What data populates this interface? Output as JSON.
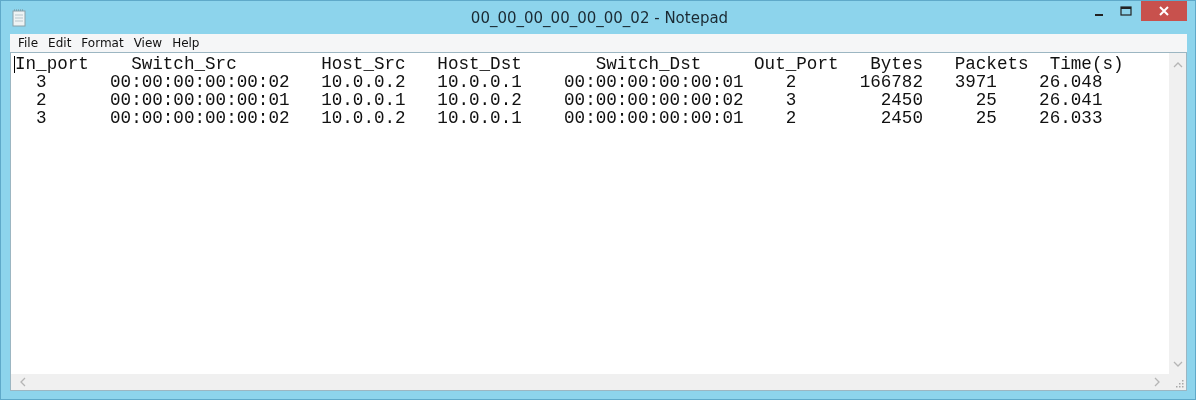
{
  "window": {
    "title": "00_00_00_00_00_00_02 - Notepad"
  },
  "menu": [
    "File",
    "Edit",
    "Format",
    "View",
    "Help"
  ],
  "document": {
    "lines": [
      "In_port    Switch_Src        Host_Src   Host_Dst       Switch_Dst     Out_Port   Bytes   Packets  Time(s)",
      "  3      00:00:00:00:00:02   10.0.0.2   10.0.0.1    00:00:00:00:00:01    2      166782   3971    26.048",
      "  2      00:00:00:00:00:01   10.0.0.1   10.0.0.2    00:00:00:00:00:02    3        2450     25    26.041",
      "  3      00:00:00:00:00:02   10.0.0.2   10.0.0.1    00:00:00:00:00:01    2        2450     25    26.033"
    ]
  }
}
